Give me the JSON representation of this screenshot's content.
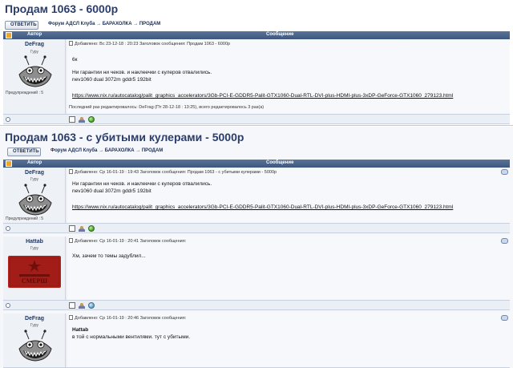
{
  "panel1": {
    "title": "Продам 1063 - 6000р",
    "reply_label": "ОТВЕТИТЬ",
    "breadcrumb": "Форум АДСЛ Клуба → БАРАХОЛКА → ПРОДАМ",
    "table_head": {
      "author": "Автор",
      "message": "Сообщение"
    },
    "post": {
      "author": "DeFrag",
      "rank": "Гуру",
      "warnings": "Предупреждений : 5",
      "meta": "Добавлено: Вс 23-12-18 : 20:23    Заголовок сообщения: Продам 1063 - 6000р",
      "lines": [
        "6к",
        "Ни гарантии ни чеков. и наклеечки с кулеров отвалились.",
        "nev1060 dual 3072m gddr5 192bit"
      ],
      "link": "https://www.nix.ru/autocatalog/palit_graphics_accelerators/3Gb-PCI-E-GDDR5-Palit-GTX1060-Dual-RTL-DVI-plus-HDMI-plus-3xDP-GeForce-GTX1060_279123.html",
      "edited": "Последний раз редактировалось: DeFrag (Пт 28-12-18 : 13:25), всего редактировалось 3 раз(а)"
    }
  },
  "panel2": {
    "title": "Продам 1063 - с убитыми кулерами - 5000р",
    "reply_label": "ОТВЕТИТЬ",
    "breadcrumb": "Форум АДСЛ Клуба → БАРАХОЛКА → ПРОДАМ",
    "table_head": {
      "author": "Автор",
      "message": "Сообщение"
    },
    "posts": [
      {
        "author": "DeFrag",
        "rank": "Гуру",
        "warnings": "Предупреждений : 5",
        "meta": "Добавлено: Ср 16-01-19 : 19:43    Заголовок сообщения: Продам 1063 - с убитыми кулерами - 5000р",
        "lines": [
          "Ни гарантии ни чеков. и наклеечки с кулеров отвалились.",
          "nev1060 dual 3072m gddr5 192bit"
        ],
        "link": "https://www.nix.ru/autocatalog/palit_graphics_accelerators/3Gb-PCI-E-GDDR5-Palit-GTX1060-Dual-RTL-DVI-plus-HDMI-plus-3xDP-GeForce-GTX1060_279123.html"
      },
      {
        "author": "Hattab",
        "rank": "Гуру",
        "meta": "Добавлено: Ср 16-01-19 : 20:41    Заголовок сообщения:",
        "lines": [
          "Хм, зачем то темы задублил..."
        ],
        "badge_text": "СМЕРШ"
      },
      {
        "author": "DeFrag",
        "rank": "Гуру",
        "meta": "Добавлено: Ср 16-01-19 : 20:46    Заголовок сообщения:",
        "quoted_name": "Hattab",
        "lines": [
          "в той с нормальными вентилями. тут с убитыми."
        ]
      }
    ]
  },
  "colors": {
    "title": "#2a3d6b",
    "header_bar": "#3c577f",
    "link": "#0b3a86",
    "badge_red": "#b1231c"
  }
}
